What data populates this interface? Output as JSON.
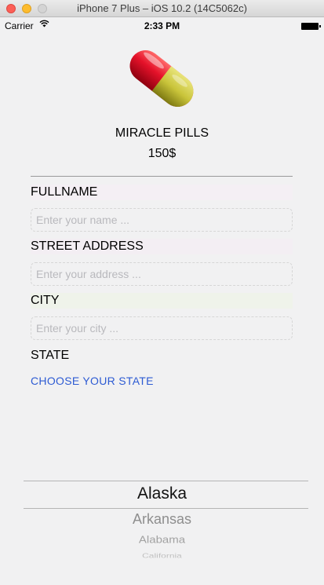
{
  "window": {
    "title": "iPhone 7 Plus – iOS 10.2 (14C5062c)"
  },
  "status_bar": {
    "carrier": "Carrier",
    "time": "2:33 PM"
  },
  "product": {
    "name": "MIRACLE PILLS",
    "price": "150$",
    "image_icon": "pill-capsule-icon"
  },
  "form": {
    "fullname_label": "FULLNAME",
    "fullname_placeholder": "Enter your name ...",
    "street_label": "STREET ADDRESS",
    "street_placeholder": "Enter your address ...",
    "city_label": "CITY",
    "city_placeholder": "Enter your city ...",
    "state_label": "STATE",
    "choose_state": "CHOOSE YOUR STATE"
  },
  "picker": {
    "selected": "Alaska",
    "rows": [
      "Alaska",
      "Arkansas",
      "Alabama",
      "California"
    ]
  },
  "colors": {
    "accent_link": "#2d5bd3",
    "pill_red": "#e5122a",
    "pill_yellow": "#c9c43a",
    "background": "#f1f1f2"
  }
}
